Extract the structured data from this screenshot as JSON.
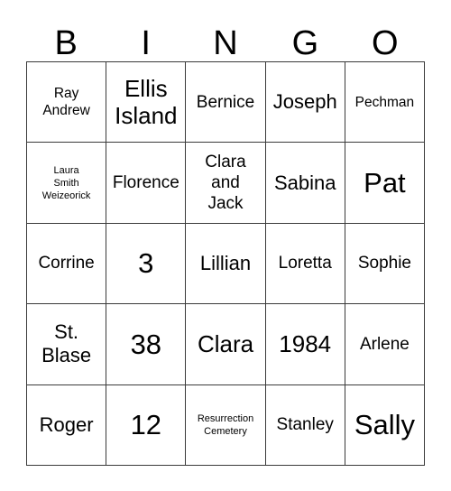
{
  "card": {
    "headers": [
      "B",
      "I",
      "N",
      "G",
      "O"
    ],
    "rows": [
      [
        {
          "text": "Ray\nAndrew",
          "size": "sm"
        },
        {
          "text": "Ellis\nIsland",
          "size": "xl"
        },
        {
          "text": "Bernice",
          "size": "md"
        },
        {
          "text": "Joseph",
          "size": "lg"
        },
        {
          "text": "Pechman",
          "size": "sm"
        }
      ],
      [
        {
          "text": "Laura\nSmith\nWeizeorick",
          "size": "xs"
        },
        {
          "text": "Florence",
          "size": "md"
        },
        {
          "text": "Clara\nand\nJack",
          "size": "md"
        },
        {
          "text": "Sabina",
          "size": "lg"
        },
        {
          "text": "Pat",
          "size": "xxl"
        }
      ],
      [
        {
          "text": "Corrine",
          "size": "md"
        },
        {
          "text": "3",
          "size": "xxl"
        },
        {
          "text": "Lillian",
          "size": "lg"
        },
        {
          "text": "Loretta",
          "size": "md"
        },
        {
          "text": "Sophie",
          "size": "md"
        }
      ],
      [
        {
          "text": "St.\nBlase",
          "size": "lg"
        },
        {
          "text": "38",
          "size": "xxl"
        },
        {
          "text": "Clara",
          "size": "xl"
        },
        {
          "text": "1984",
          "size": "xl"
        },
        {
          "text": "Arlene",
          "size": "md"
        }
      ],
      [
        {
          "text": "Roger",
          "size": "lg"
        },
        {
          "text": "12",
          "size": "xxl"
        },
        {
          "text": "Resurrection\nCemetery",
          "size": "xs"
        },
        {
          "text": "Stanley",
          "size": "md"
        },
        {
          "text": "Sally",
          "size": "xxl"
        }
      ]
    ]
  },
  "style": {
    "border_color": "#3a3a3a",
    "text_color": "#000000",
    "background": "#ffffff"
  }
}
